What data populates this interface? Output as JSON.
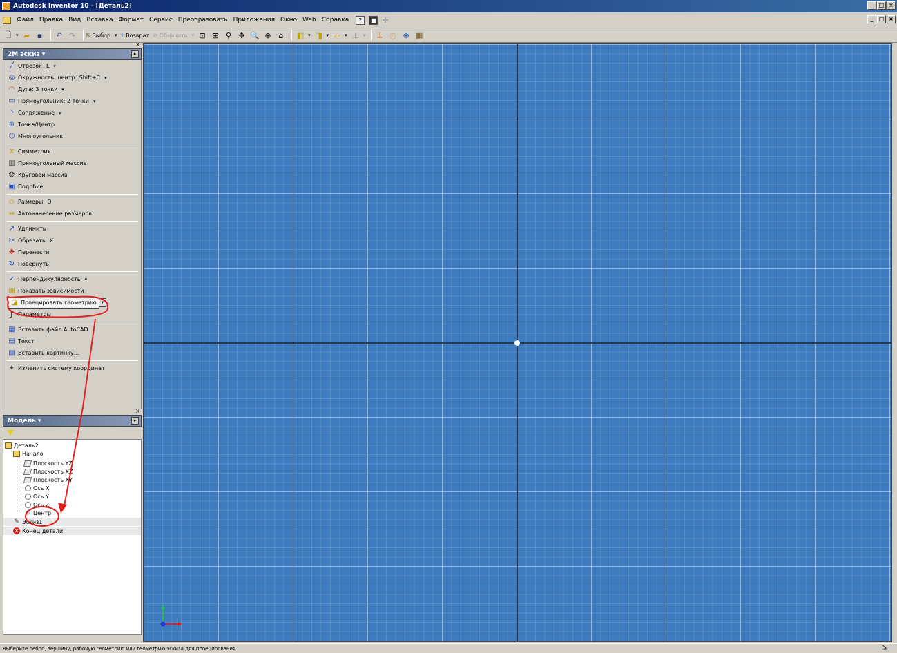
{
  "window": {
    "title": "Autodesk Inventor 10 - [Деталь2]"
  },
  "menu": [
    "Файл",
    "Правка",
    "Вид",
    "Вставка",
    "Формат",
    "Сервис",
    "Преобразовать",
    "Приложения",
    "Окно",
    "Web",
    "Справка"
  ],
  "toolbar": {
    "select_label": "Выбор",
    "return_label": "Возврат",
    "update_label": "Обновить"
  },
  "sketch_panel": {
    "title": "2М эскиз",
    "commands": [
      {
        "label": "Отрезок",
        "shortcut": "L",
        "dropdown": true,
        "icon": "line-icon"
      },
      {
        "label": "Окружность: центр",
        "shortcut": "Shift+C",
        "dropdown": true,
        "icon": "circle-icon"
      },
      {
        "label": "Дуга: 3 точки",
        "shortcut": "",
        "dropdown": true,
        "icon": "arc-icon"
      },
      {
        "label": "Прямоугольник: 2 точки",
        "shortcut": "",
        "dropdown": true,
        "icon": "rectangle-icon"
      },
      {
        "label": "Сопряжение",
        "shortcut": "",
        "dropdown": true,
        "icon": "fillet-icon"
      },
      {
        "label": "Точка/Центр",
        "shortcut": "",
        "dropdown": false,
        "icon": "point-icon"
      },
      {
        "label": "Многоугольник",
        "shortcut": "",
        "dropdown": false,
        "icon": "polygon-icon"
      },
      {
        "sep": true
      },
      {
        "label": "Симметрия",
        "shortcut": "",
        "dropdown": false,
        "icon": "mirror-icon"
      },
      {
        "label": "Прямоугольный массив",
        "shortcut": "",
        "dropdown": false,
        "icon": "rect-pattern-icon"
      },
      {
        "label": "Круговой массив",
        "shortcut": "",
        "dropdown": false,
        "icon": "circ-pattern-icon"
      },
      {
        "label": "Подобие",
        "shortcut": "",
        "dropdown": false,
        "icon": "offset-icon"
      },
      {
        "sep": true
      },
      {
        "label": "Размеры",
        "shortcut": "D",
        "dropdown": false,
        "icon": "dimension-icon"
      },
      {
        "label": "Автонанесение размеров",
        "shortcut": "",
        "dropdown": false,
        "icon": "auto-dimension-icon"
      },
      {
        "sep": true
      },
      {
        "label": "Удлинить",
        "shortcut": "",
        "dropdown": false,
        "icon": "extend-icon"
      },
      {
        "label": "Обрезать",
        "shortcut": "X",
        "dropdown": false,
        "icon": "trim-icon"
      },
      {
        "label": "Перенести",
        "shortcut": "",
        "dropdown": false,
        "icon": "move-icon"
      },
      {
        "label": "Повернуть",
        "shortcut": "",
        "dropdown": false,
        "icon": "rotate-icon"
      },
      {
        "sep": true
      },
      {
        "label": "Перпендикулярность",
        "shortcut": "",
        "dropdown": true,
        "icon": "perpendicular-icon"
      },
      {
        "label": "Показать зависимости",
        "shortcut": "",
        "dropdown": false,
        "icon": "constraints-icon"
      },
      {
        "label": "Проецировать геометрию",
        "shortcut": "",
        "dropdown": true,
        "icon": "project-geometry-icon",
        "boxed": true
      },
      {
        "label": "Параметры",
        "shortcut": "",
        "dropdown": false,
        "icon": "parameters-icon"
      },
      {
        "sep": true
      },
      {
        "label": "Вставить файл AutoCAD",
        "shortcut": "",
        "dropdown": false,
        "icon": "autocad-icon"
      },
      {
        "label": "Текст",
        "shortcut": "",
        "dropdown": false,
        "icon": "text-icon"
      },
      {
        "label": "Вставить картинку...",
        "shortcut": "",
        "dropdown": false,
        "icon": "image-icon"
      },
      {
        "sep": true
      },
      {
        "label": "Изменить систему координат",
        "shortcut": "",
        "dropdown": false,
        "icon": "coordinate-system-icon"
      }
    ]
  },
  "model_panel": {
    "title": "Модель",
    "tree": [
      {
        "label": "Деталь2",
        "level": 0,
        "icon": "part-icon"
      },
      {
        "label": "Начало",
        "level": 1,
        "icon": "folder-icon"
      },
      {
        "label": "Плоскость YZ",
        "level": 2,
        "icon": "plane-icon"
      },
      {
        "label": "Плоскость XZ",
        "level": 2,
        "icon": "plane-icon"
      },
      {
        "label": "Плоскость XY",
        "level": 2,
        "icon": "plane-icon"
      },
      {
        "label": "Ось X",
        "level": 2,
        "icon": "axis-icon"
      },
      {
        "label": "Ось Y",
        "level": 2,
        "icon": "axis-icon"
      },
      {
        "label": "Ось Z",
        "level": 2,
        "icon": "axis-icon"
      },
      {
        "label": "Центр",
        "level": 2,
        "icon": "center-point-icon"
      },
      {
        "label": "Эскиз1",
        "level": 1,
        "icon": "sketch-icon"
      },
      {
        "label": "Конец детали",
        "level": 1,
        "icon": "end-of-part-icon"
      }
    ]
  },
  "status_text": "Выберите ребро, вершину, рабочую геометрию или геометрию эскиза для проецирования.",
  "colors": {
    "canvas": "#3e7cbf",
    "annotation": "#e02020",
    "title_bar": "#0a246a"
  }
}
